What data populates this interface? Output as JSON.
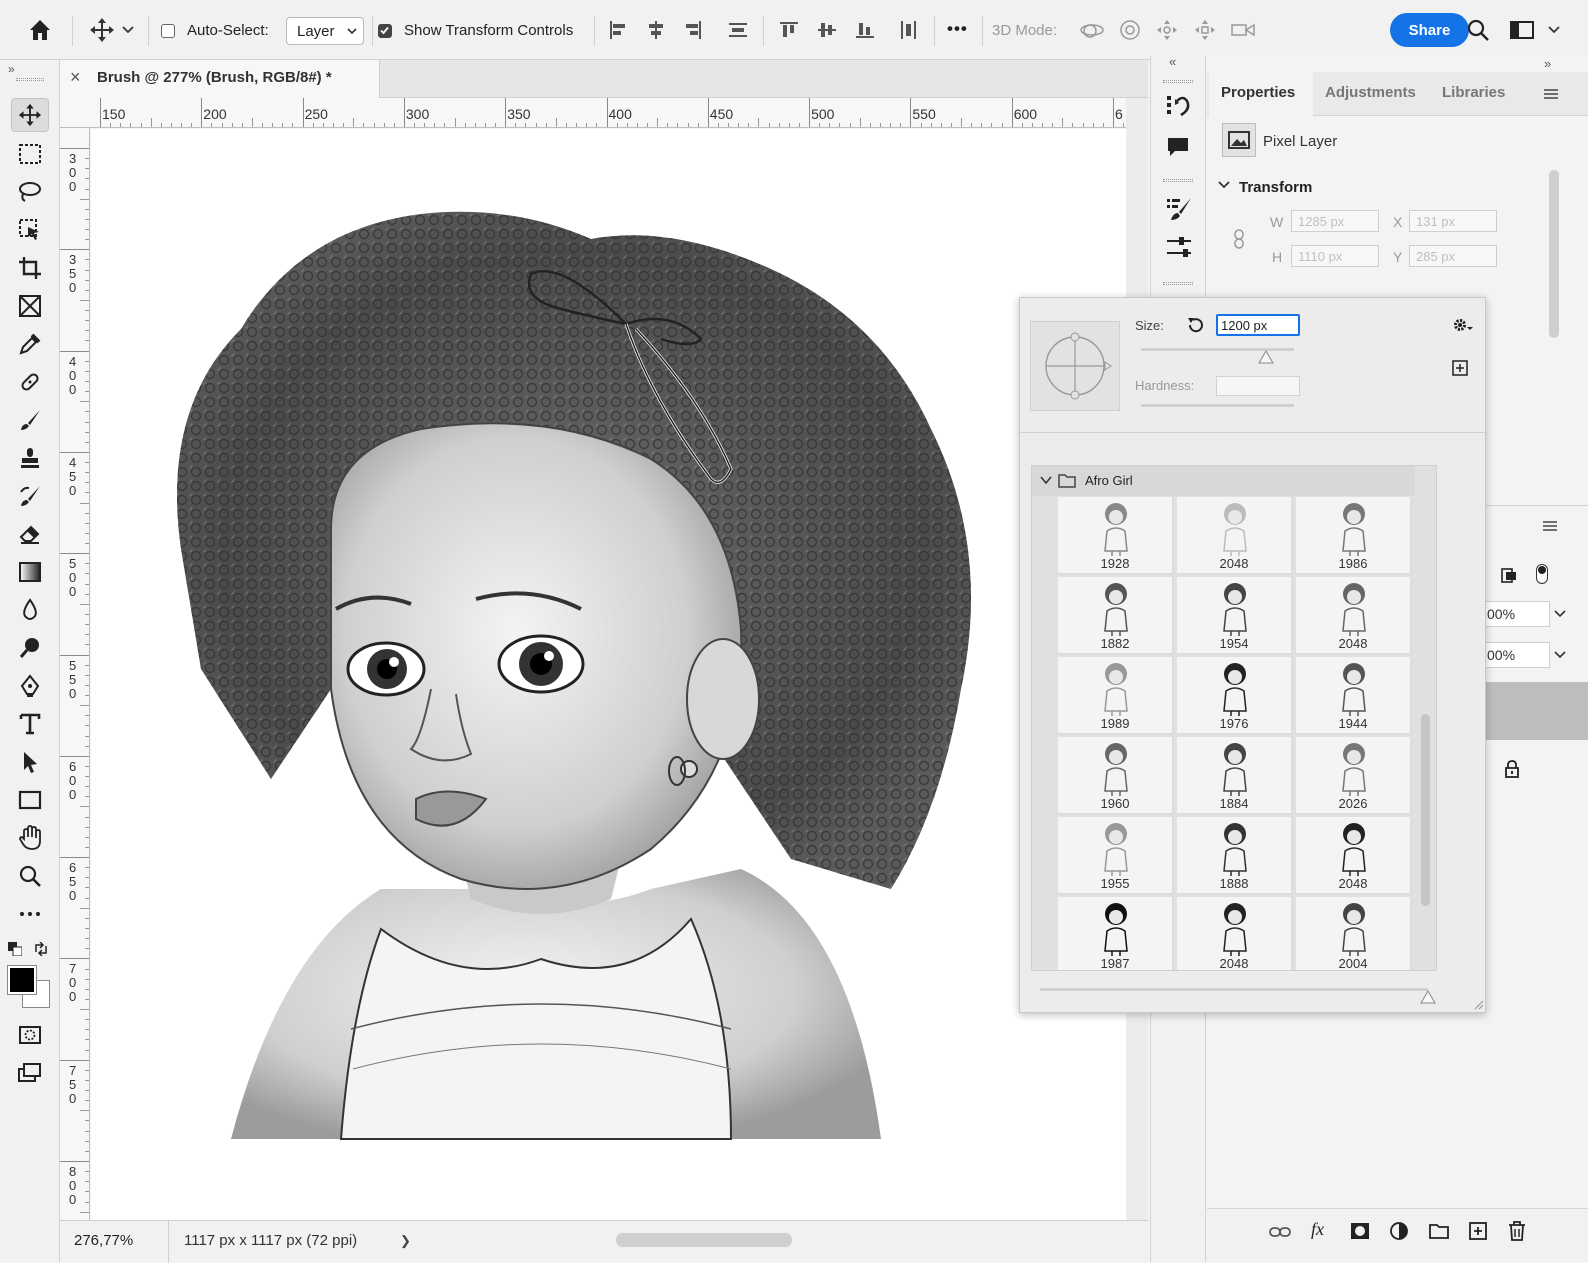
{
  "options_bar": {
    "auto_select_label": "Auto-Select:",
    "auto_select_value": "Layer",
    "show_transform_label": "Show Transform Controls",
    "mode_3d_label": "3D Mode:",
    "share_label": "Share",
    "more_label": "•••"
  },
  "document": {
    "tab_title": "Brush @ 277% (Brush, RGB/8#) *",
    "close_glyph": "×"
  },
  "ruler": {
    "h_ticks": [
      "150",
      "200",
      "250",
      "300",
      "350",
      "400",
      "450",
      "500",
      "550",
      "600",
      "6"
    ],
    "v_ticks": [
      "300",
      "350",
      "400",
      "450",
      "500",
      "550",
      "600",
      "650",
      "700",
      "750",
      "800"
    ]
  },
  "status_bar": {
    "zoom": "276,77%",
    "dimensions": "1117 px x 1117 px (72 ppi)",
    "arrow": "❯"
  },
  "properties_panel": {
    "tabs": [
      "Properties",
      "Adjustments",
      "Libraries"
    ],
    "layer_type": "Pixel Layer",
    "section": "Transform",
    "w_label": "W",
    "w_value": "1285 px",
    "h_label": "H",
    "h_value": "1110 px",
    "x_label": "X",
    "x_value": "131 px",
    "y_label": "Y",
    "y_value": "285 px"
  },
  "layers_panel_partial": {
    "opacity_1": "00%",
    "opacity_2": "00%"
  },
  "brush_popup": {
    "size_label": "Size:",
    "size_value": "1200 px",
    "hardness_label": "Hardness:",
    "folder_name": "Afro Girl",
    "brushes": [
      "1928",
      "2048",
      "1986",
      "1882",
      "1954",
      "2048",
      "1989",
      "1976",
      "1944",
      "1960",
      "1884",
      "2026",
      "1955",
      "1888",
      "2048",
      "1987",
      "2048",
      "2004"
    ],
    "slider_position": 0.82
  },
  "colors": {
    "accent": "#1473e6",
    "foreground": "#000000",
    "background": "#ffffff"
  },
  "icons": [
    "home-icon",
    "move-icon",
    "align-icon",
    "3d-icon",
    "search-icon",
    "workspace-icon",
    "marquee-icon",
    "lasso-icon",
    "crop-icon",
    "eyedropper-icon",
    "brush-icon",
    "stamp-icon",
    "eraser-icon",
    "gradient-icon",
    "pen-icon",
    "type-icon",
    "hand-icon",
    "zoom-icon"
  ]
}
